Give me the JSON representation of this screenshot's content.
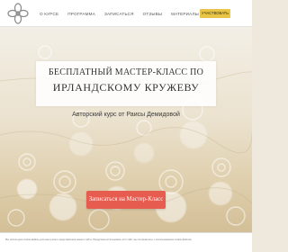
{
  "nav": {
    "items": [
      {
        "label": "О КУРСЕ"
      },
      {
        "label": "ПРОГРАММА"
      },
      {
        "label": "ЗАПИСАТЬСЯ"
      },
      {
        "label": "ОТЗЫВЫ"
      },
      {
        "label": "МАТЕРИАЛЫ"
      },
      {
        "label": "ВОПРОСЫ"
      }
    ],
    "cta_label": "УЧАСТВОВАТЬ"
  },
  "hero": {
    "title_line1": "БЕСПЛАТНЫЙ МАСТЕР-КЛАСС ПО",
    "title_line2": "ИРЛАНДСКОМУ КРУЖЕВУ",
    "subtitle": "Авторский курс от Раисы Демидовой",
    "cta_label": "Записаться на Мастер-Класс"
  },
  "cookie": {
    "text": "Мы используем cookie-файлы для наилучшего представления нашего сайта. Продолжая использовать этот сайт, вы соглашаетесь с использованием cookie-файлов."
  },
  "colors": {
    "accent_cta": "#e65c4f",
    "top_cta": "#e8c547"
  }
}
